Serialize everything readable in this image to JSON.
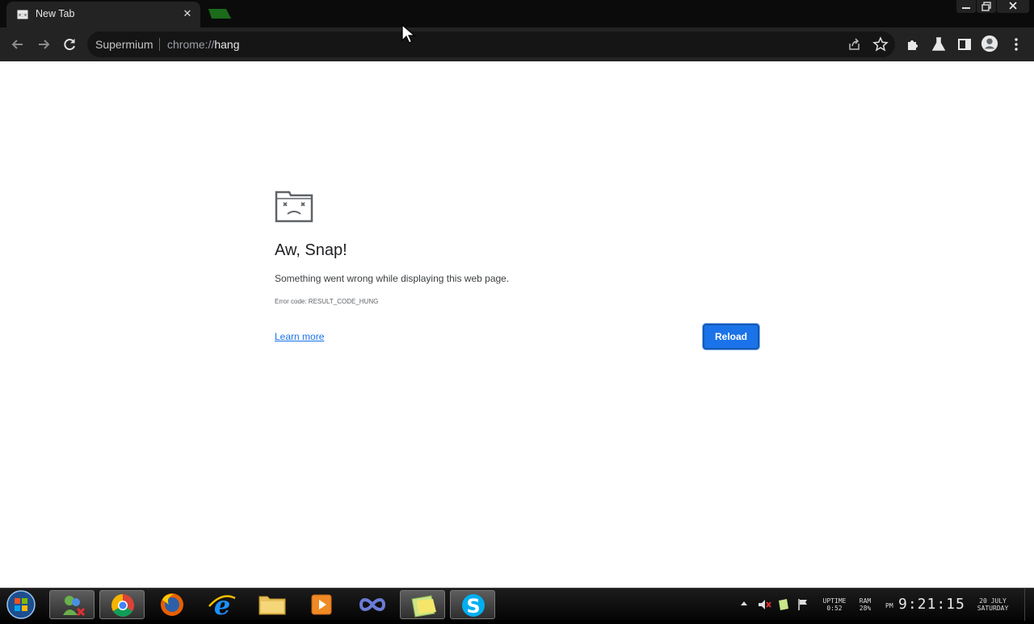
{
  "browser": {
    "tab": {
      "title": "New Tab",
      "close_glyph": "✕"
    },
    "omnibox": {
      "site_name": "Supermium",
      "url_prefix": "chrome://",
      "url_host": "hang"
    }
  },
  "page": {
    "heading": "Aw, Snap!",
    "message": "Something went wrong while displaying this web page.",
    "error_code": "Error code: RESULT_CODE_HUNG",
    "learn_more": "Learn more",
    "reload_label": "Reload"
  },
  "taskbar": {
    "uptime_label": "UPTIME",
    "uptime_value": "0:52",
    "ram_label": "RAM",
    "ram_value": "28%",
    "ampm": "PM",
    "time": "9:21:15",
    "date": "20 JULY",
    "weekday": "SATURDAY"
  },
  "colors": {
    "accent": "#1a73e8",
    "chrome_dark": "#232323"
  }
}
